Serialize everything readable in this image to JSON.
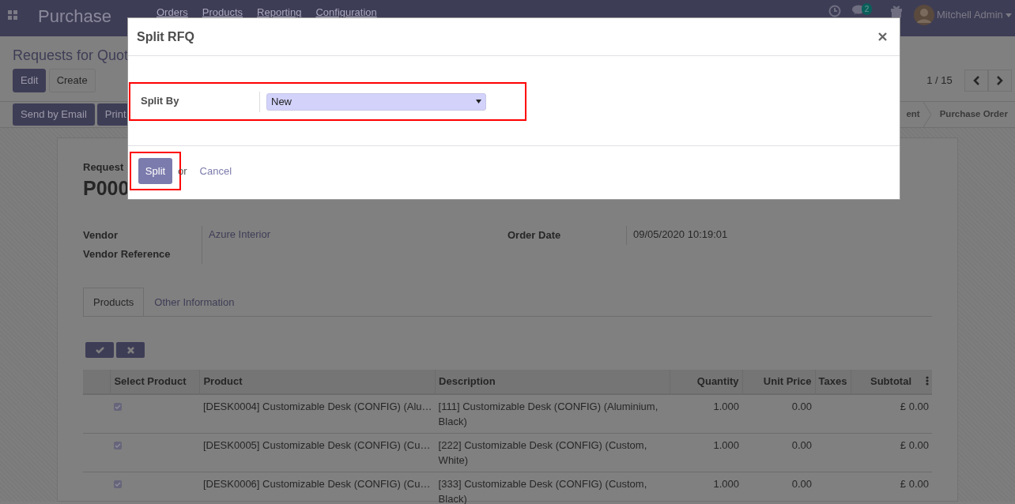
{
  "app": {
    "title": "Purchase",
    "menu": [
      "Orders",
      "Products",
      "Reporting",
      "Configuration"
    ],
    "message_count": "2",
    "user": "Mitchell Admin"
  },
  "control_panel": {
    "breadcrumb": "Requests for Quot",
    "buttons": [
      {
        "label": "Edit",
        "kind": "primary"
      },
      {
        "label": "Create",
        "kind": "secondary"
      }
    ],
    "pager": "1 / 15",
    "actions": [
      "Send by Email",
      "Print"
    ],
    "statuses": [
      {
        "label": "ent",
        "selected": false
      },
      {
        "label": "Purchase Order",
        "selected": false
      }
    ]
  },
  "form": {
    "subtitle": "Request",
    "name": "P000",
    "fields_left": [
      {
        "label": "Vendor",
        "value": "Azure Interior",
        "kind": "link"
      },
      {
        "label": "Vendor Reference",
        "kind": "empty"
      }
    ],
    "fields_right": [
      {
        "label": "Order Date",
        "value": "09/05/2020 10:19:01",
        "kind": "text"
      }
    ],
    "tabs": [
      {
        "label": "Products",
        "selected": true
      },
      {
        "label": "Other Information",
        "selected": false
      }
    ],
    "columns": [
      "Select Product",
      "Product",
      "Description",
      "Quantity",
      "Unit Price",
      "Taxes",
      "Subtotal"
    ],
    "rows": [
      {
        "checked": true,
        "product": "[DESK0004] Customizable Desk (CONFIG) (Alu…",
        "description": "[111] Customizable Desk (CONFIG) (Aluminium, Black)",
        "quantity": "1.000",
        "unit_price": "0.00",
        "subtotal": "£ 0.00"
      },
      {
        "checked": true,
        "product": "[DESK0005] Customizable Desk (CONFIG) (Cu…",
        "description": "[222] Customizable Desk (CONFIG) (Custom, White)",
        "quantity": "1.000",
        "unit_price": "0.00",
        "subtotal": "£ 0.00"
      },
      {
        "checked": true,
        "product": "[DESK0006] Customizable Desk (CONFIG) (Cu…",
        "description": "[333] Customizable Desk (CONFIG) (Custom, Black)",
        "quantity": "1.000",
        "unit_price": "0.00",
        "subtotal": "£ 0.00"
      }
    ]
  },
  "dialog": {
    "title": "Split RFQ",
    "field": {
      "label": "Split By",
      "value": "New"
    },
    "primary": "Split",
    "separator": "or",
    "cancel": "Cancel"
  }
}
